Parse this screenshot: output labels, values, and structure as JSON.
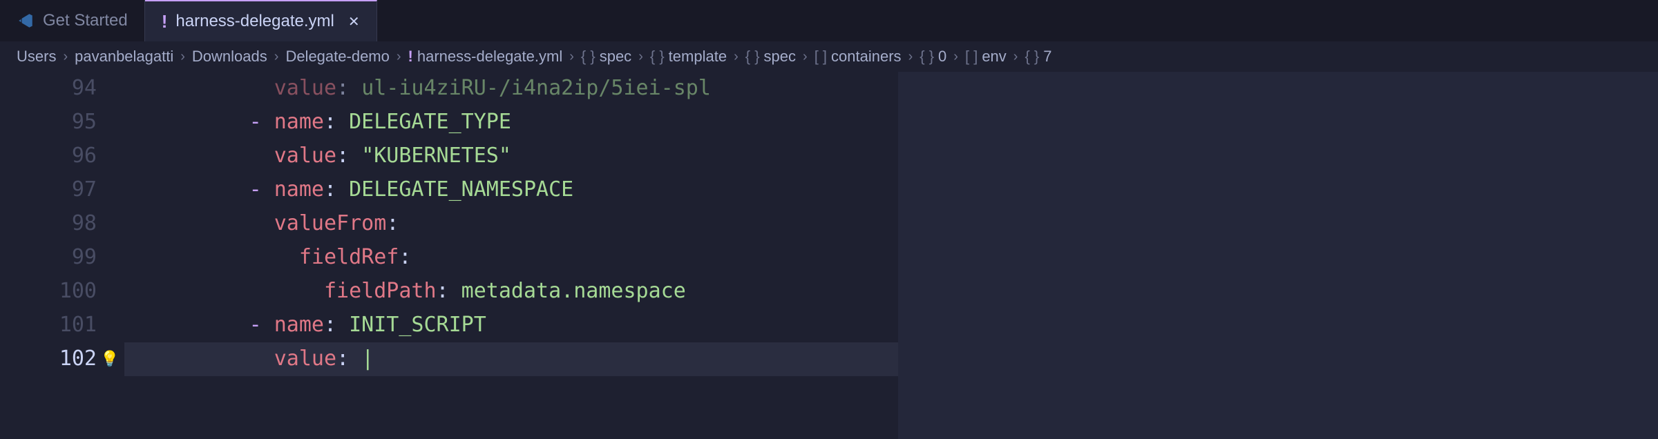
{
  "tabs": [
    {
      "label": "Get Started",
      "icon": "vscode",
      "active": false
    },
    {
      "label": "harness-delegate.yml",
      "icon": "exclaim",
      "active": true
    }
  ],
  "breadcrumbs": [
    {
      "label": "Users",
      "icon": ""
    },
    {
      "label": "pavanbelagatti",
      "icon": ""
    },
    {
      "label": "Downloads",
      "icon": ""
    },
    {
      "label": "Delegate-demo",
      "icon": ""
    },
    {
      "label": "harness-delegate.yml",
      "icon": "!"
    },
    {
      "label": "spec",
      "icon": "{}"
    },
    {
      "label": "template",
      "icon": "{}"
    },
    {
      "label": "spec",
      "icon": "{}"
    },
    {
      "label": "containers",
      "icon": "[ ]"
    },
    {
      "label": "0",
      "icon": "{}"
    },
    {
      "label": "env",
      "icon": "[ ]"
    },
    {
      "label": "7",
      "icon": "{}"
    }
  ],
  "lines": {
    "94": {
      "indent": "            ",
      "key": "value",
      "sep": ": ",
      "val": "ul-iu4ziRU-/i4na2ip/5iei-spl"
    },
    "95": {
      "indent": "          ",
      "dash": "- ",
      "key": "name",
      "sep": ": ",
      "val": "DELEGATE_TYPE"
    },
    "96": {
      "indent": "            ",
      "key": "value",
      "sep": ": ",
      "val": "\"KUBERNETES\""
    },
    "97": {
      "indent": "          ",
      "dash": "- ",
      "key": "name",
      "sep": ": ",
      "val": "DELEGATE_NAMESPACE"
    },
    "98": {
      "indent": "            ",
      "key": "valueFrom",
      "sep": ":",
      "val": ""
    },
    "99": {
      "indent": "              ",
      "key": "fieldRef",
      "sep": ":",
      "val": ""
    },
    "100": {
      "indent": "                ",
      "key": "fieldPath",
      "sep": ": ",
      "val": "metadata.namespace"
    },
    "101": {
      "indent": "          ",
      "dash": "- ",
      "key": "name",
      "sep": ": ",
      "val": "INIT_SCRIPT"
    },
    "102": {
      "indent": "            ",
      "key": "value",
      "sep": ": ",
      "val": "|"
    }
  },
  "line_numbers": [
    "94",
    "95",
    "96",
    "97",
    "98",
    "99",
    "100",
    "101",
    "102"
  ],
  "active_line": "102"
}
